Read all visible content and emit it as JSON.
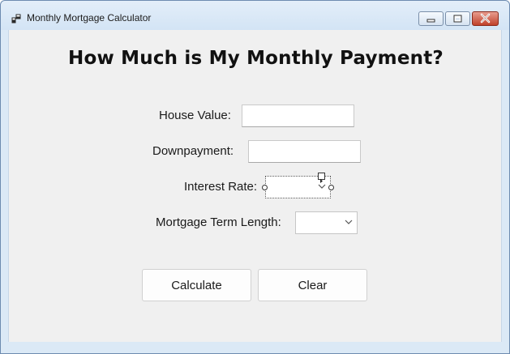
{
  "window": {
    "title": "Monthly Mortgage Calculator",
    "icon": "form-icon",
    "controls": [
      "minimize-icon",
      "maximize-icon",
      "close-icon"
    ]
  },
  "form": {
    "heading": "How Much is My Monthly Payment?",
    "house_value": {
      "label": "House Value:",
      "value": ""
    },
    "downpayment": {
      "label": "Downpayment:",
      "value": ""
    },
    "interest_rate": {
      "label": "Interest Rate:",
      "selected": ""
    },
    "term_length": {
      "label": "Mortgage Term Length:",
      "selected": ""
    }
  },
  "buttons": {
    "calculate": "Calculate",
    "clear": "Clear"
  },
  "colors": {
    "titlebar": "#dbe9f6",
    "client_background": "#f0f0f0",
    "close_button": "#c0412b"
  }
}
